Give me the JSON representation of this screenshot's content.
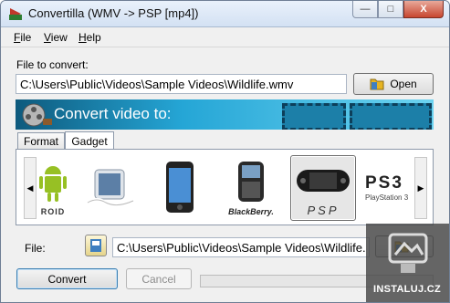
{
  "window": {
    "title": "Convertilla  (WMV -> PSP [mp4])",
    "controls": {
      "minimize_glyph": "—",
      "maximize_glyph": "□",
      "close_glyph": "X"
    }
  },
  "menu": [
    {
      "accel": "F",
      "rest": "ile"
    },
    {
      "accel": "V",
      "rest": "iew"
    },
    {
      "accel": "H",
      "rest": "elp"
    }
  ],
  "source": {
    "label": "File to convert:",
    "path": "C:\\Users\\Public\\Videos\\Sample Videos\\Wildlife.wmv",
    "open_label": "Open"
  },
  "banner": {
    "text": "Convert video to:"
  },
  "tabs": [
    {
      "label": "Format",
      "active": false
    },
    {
      "label": "Gadget",
      "active": true
    }
  ],
  "gadgets": {
    "items": [
      {
        "name": "Android",
        "caption": "ROID",
        "icon": "android-icon",
        "selected": false
      },
      {
        "name": "iPod nano",
        "caption": "",
        "icon": "ipod-nano-icon",
        "selected": false
      },
      {
        "name": "iPod touch",
        "caption": "",
        "icon": "ipod-touch-icon",
        "selected": false
      },
      {
        "name": "BlackBerry",
        "caption": "BlackBerry.",
        "icon": "blackberry-icon",
        "selected": false
      },
      {
        "name": "PSP",
        "caption": "PSP",
        "icon": "psp-icon",
        "selected": true
      },
      {
        "name": "PS3",
        "caption": "PlayStation 3",
        "logo": "PS3",
        "icon": "ps3-icon",
        "selected": false
      }
    ],
    "left_arrow": "◀",
    "right_arrow": "▶"
  },
  "output": {
    "label": "File:",
    "path": "C:\\Users\\Public\\Videos\\Sample Videos\\Wildlife.mp4"
  },
  "actions": {
    "convert_label": "Convert",
    "cancel_label": "Cancel"
  },
  "progress": {
    "value": 0
  },
  "watermark": {
    "text": "INSTALUJ.CZ"
  },
  "colors": {
    "banner_start": "#0e5a7d",
    "banner_end": "#6dd3f0",
    "accent": "#3c7fb1"
  }
}
